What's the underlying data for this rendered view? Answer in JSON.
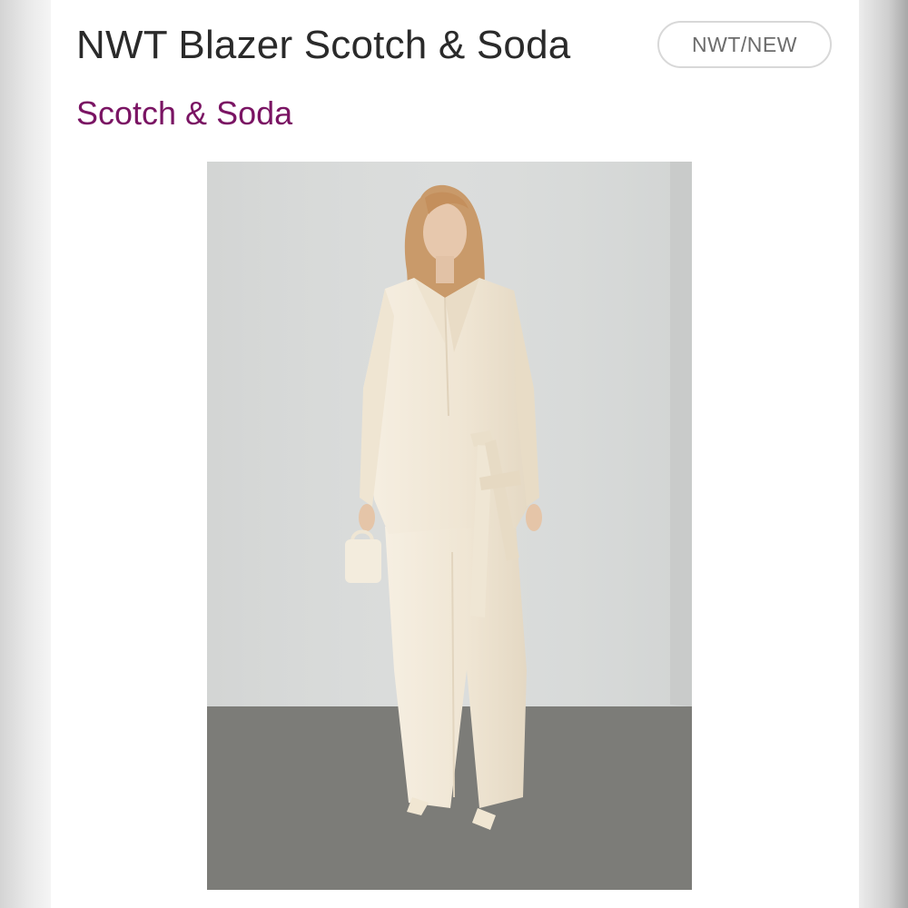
{
  "listing": {
    "title": "NWT Blazer Scotch & Soda",
    "condition_badge": "NWT/NEW",
    "brand": "Scotch & Soda"
  },
  "photo": {
    "subject": "model-in-cream-suit",
    "colors": {
      "wall": "#d7d9d8",
      "floor": "#7c7c78",
      "suit": "#f1e8d8",
      "hair": "#c99a6a",
      "skin": "#e7c8ad"
    }
  },
  "colors": {
    "brand_accent": "#7a1463",
    "title_text": "#2a2a2a",
    "badge_text": "#6c6c6c",
    "badge_border": "#d8d8d8"
  }
}
